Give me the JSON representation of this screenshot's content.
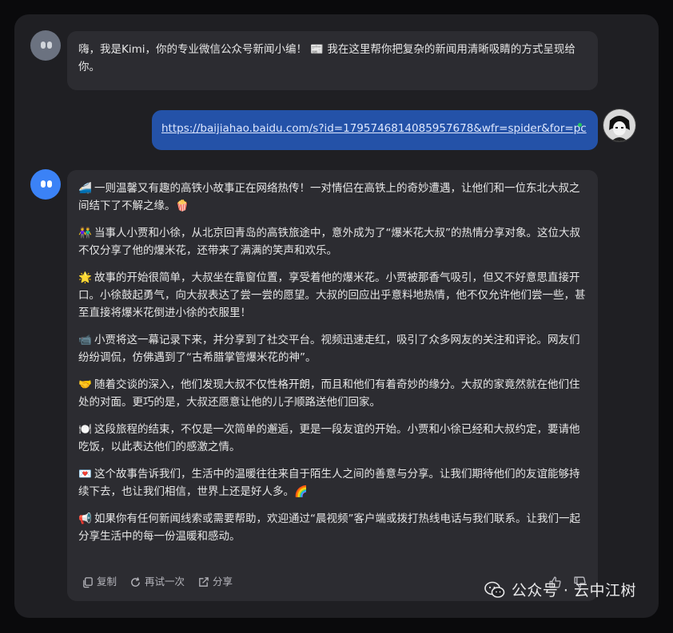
{
  "greeting": {
    "text_before": "嗨，我是Kimi，你的专业微信公众号新闻小编！",
    "emoji": "📰",
    "text_after": "我在这里帮你把复杂的新闻用清晰吸睛的方式呈现给你。"
  },
  "user_message": {
    "link": "https://baijiahao.baidu.com/s?id=1795746814085957678&wfr=spider&for=pc"
  },
  "reply": {
    "paragraphs": [
      {
        "emoji": "🚄",
        "text": "一则温馨又有趣的高铁小故事正在网络热传！一对情侣在高铁上的奇妙遭遇，让他们和一位东北大叔之间结下了不解之缘。🍿"
      },
      {
        "emoji": "👫",
        "text": "当事人小贾和小徐，从北京回青岛的高铁旅途中，意外成为了“爆米花大叔”的热情分享对象。这位大叔不仅分享了他的爆米花，还带来了满满的笑声和欢乐。"
      },
      {
        "emoji": "🌟",
        "text": "故事的开始很简单，大叔坐在靠窗位置，享受着他的爆米花。小贾被那香气吸引，但又不好意思直接开口。小徐鼓起勇气，向大叔表达了尝一尝的愿望。大叔的回应出乎意料地热情，他不仅允许他们尝一些，甚至直接将爆米花倒进小徐的衣服里！"
      },
      {
        "emoji": "📹",
        "text": "小贾将这一幕记录下来，并分享到了社交平台。视频迅速走红，吸引了众多网友的关注和评论。网友们纷纷调侃，仿佛遇到了“古希腊掌管爆米花的神”。"
      },
      {
        "emoji": "🤝",
        "text": "随着交谈的深入，他们发现大叔不仅性格开朗，而且和他们有着奇妙的缘分。大叔的家竟然就在他们住处的对面。更巧的是，大叔还愿意让他的儿子顺路送他们回家。"
      },
      {
        "emoji": "🍽️",
        "text": "这段旅程的结束，不仅是一次简单的邂逅，更是一段友谊的开始。小贾和小徐已经和大叔约定，要请他吃饭，以此表达他们的感激之情。"
      },
      {
        "emoji": "💌",
        "text": "这个故事告诉我们，生活中的温暖往往来自于陌生人之间的善意与分享。让我们期待他们的友谊能够持续下去，也让我们相信，世界上还是好人多。🌈"
      },
      {
        "emoji": "📢",
        "text": "如果你有任何新闻线索或需要帮助，欢迎通过“晨视频”客户端或拨打热线电话与我们联系。让我们一起分享生活中的每一份温暖和感动。"
      }
    ],
    "actions": {
      "copy": "复制",
      "retry": "再试一次",
      "share": "分享"
    }
  },
  "watermark": {
    "text": "公众号 · 云中江树"
  },
  "colors": {
    "window_bg": "#1f1f23",
    "bubble_bg": "#2c2c31",
    "user_bubble_bg": "#2452a8",
    "bot_avatar_active": "#3b82f6"
  }
}
